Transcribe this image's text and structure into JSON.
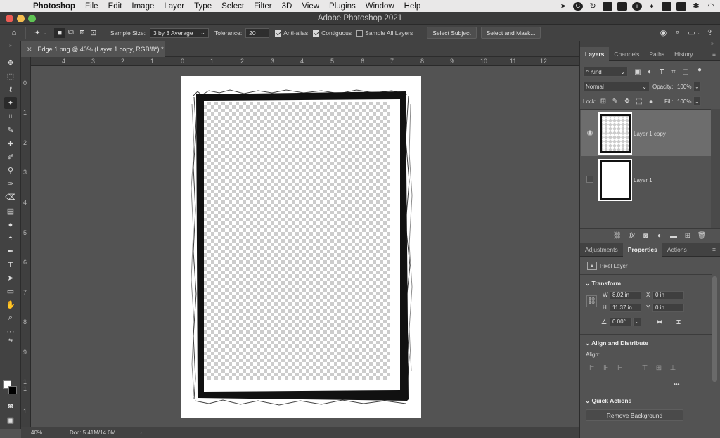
{
  "menubar": {
    "app": "Photoshop",
    "items": [
      "File",
      "Edit",
      "Image",
      "Layer",
      "Type",
      "Select",
      "Filter",
      "3D",
      "View",
      "Plugins",
      "Window",
      "Help"
    ]
  },
  "window": {
    "title": "Adobe Photoshop 2021"
  },
  "options": {
    "sample_size_label": "Sample Size:",
    "sample_size_value": "3 by 3 Average",
    "tolerance_label": "Tolerance:",
    "tolerance_value": "20",
    "anti_alias": "Anti-alias",
    "contiguous": "Contiguous",
    "sample_all_layers": "Sample All Layers",
    "select_subject": "Select Subject",
    "select_and_mask": "Select and Mask..."
  },
  "document": {
    "tab_title": "Edge 1.png @ 40% (Layer 1 copy, RGB/8*) *",
    "zoom": "40%",
    "doc_size": "Doc: 5.41M/14.0M"
  },
  "rulers": {
    "h": [
      "4",
      "3",
      "2",
      "1",
      "0",
      "1",
      "2",
      "3",
      "4",
      "5",
      "6",
      "7",
      "8",
      "9",
      "10",
      "11",
      "12"
    ],
    "v": [
      "0",
      "1",
      "2",
      "3",
      "4",
      "5",
      "6",
      "7",
      "8",
      "9",
      "1",
      "1",
      "1"
    ]
  },
  "layers_panel": {
    "tabs": [
      "Layers",
      "Channels",
      "Paths",
      "History"
    ],
    "filter_kind": "Kind",
    "blend_mode": "Normal",
    "opacity_label": "Opacity:",
    "opacity_value": "100%",
    "lock_label": "Lock:",
    "fill_label": "Fill:",
    "fill_value": "100%",
    "layers": [
      {
        "name": "Layer 1 copy"
      },
      {
        "name": "Layer 1"
      }
    ]
  },
  "properties_panel": {
    "tabs": [
      "Adjustments",
      "Properties",
      "Actions"
    ],
    "kind": "Pixel Layer",
    "transform_title": "Transform",
    "w_label": "W",
    "w_value": "8.02 in",
    "x_label": "X",
    "x_value": "0 in",
    "h_label": "H",
    "h_value": "11.37 in",
    "y_label": "Y",
    "y_value": "0 in",
    "angle_value": "0.00°",
    "align_title": "Align and Distribute",
    "align_label": "Align:",
    "more": "•••",
    "quick_actions_title": "Quick Actions",
    "remove_background": "Remove Background"
  },
  "colors": {
    "panel": "#535353",
    "bar": "#424242",
    "accent": "#3d83c4"
  }
}
